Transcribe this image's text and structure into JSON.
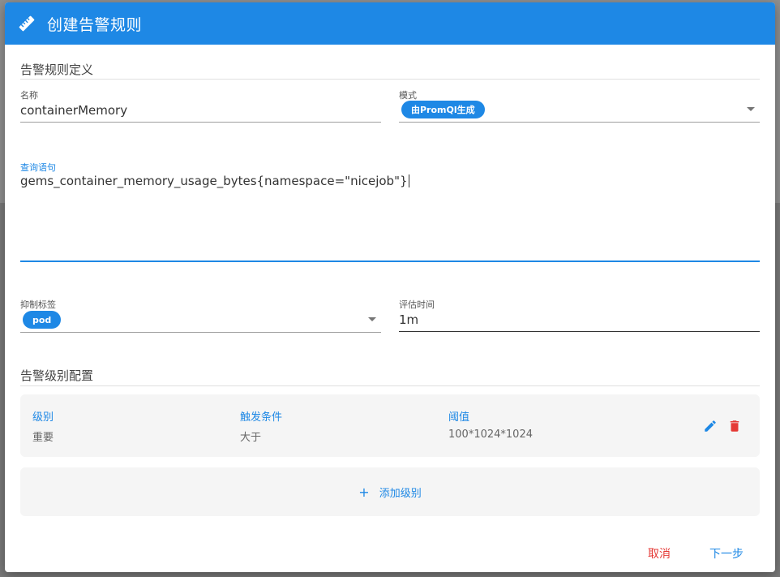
{
  "dialog": {
    "title": "创建告警规则",
    "title_icon": "ruler-icon"
  },
  "rule_definition": {
    "section_title": "告警规则定义",
    "name": {
      "label": "名称",
      "value": "containerMemory"
    },
    "mode": {
      "label": "模式",
      "value": "由PromQl生成"
    },
    "query": {
      "label": "查询语句",
      "value": "gems_container_memory_usage_bytes{namespace=\"nicejob\"}"
    },
    "suppress_labels": {
      "label": "抑制标签",
      "chips": [
        "pod"
      ]
    },
    "eval_time": {
      "label": "评估时间",
      "value": "1m"
    }
  },
  "alert_levels": {
    "section_title": "告警级别配置",
    "columns": [
      "级别",
      "触发条件",
      "阈值"
    ],
    "rows": [
      {
        "level": "重要",
        "condition": "大于",
        "threshold": "100*1024*1024"
      }
    ],
    "add_label": "添加级别",
    "add_icon": "plus-icon",
    "edit_icon": "pencil-icon",
    "delete_icon": "trash-icon"
  },
  "footer": {
    "cancel_label": "取消",
    "next_label": "下一步"
  },
  "colors": {
    "primary": "#1e88e5",
    "danger": "#e53935",
    "card_bg": "#f5f5f5"
  }
}
